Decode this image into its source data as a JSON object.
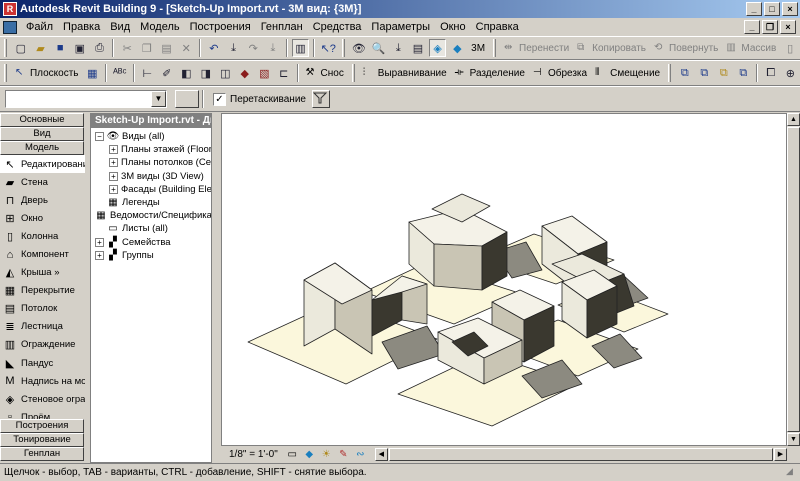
{
  "window": {
    "title": "Autodesk Revit Building 9 - [Sketch-Up Import.rvt - 3M вид: {3M}]",
    "app_icon": "R"
  },
  "menu": [
    "Файл",
    "Правка",
    "Вид",
    "Модель",
    "Построения",
    "Генплан",
    "Средства",
    "Параметры",
    "Окно",
    "Справка"
  ],
  "toolbar1": {
    "view_3d_label": "3M",
    "move_label": "Перенести",
    "copy_label": "Копировать",
    "rotate_label": "Повернуть",
    "array_label": "Массив"
  },
  "toolbar2": {
    "plane_label": "Плоскость",
    "demolish_label": "Снос",
    "align_label": "Выравнивание",
    "split_label": "Разделение",
    "trim_label": "Обрезка",
    "offset_label": "Смещение"
  },
  "optionsbar": {
    "drag_label": "Перетаскивание",
    "drag_checked": "✓"
  },
  "design_bar": {
    "top_tabs": [
      "Основные",
      "Вид",
      "Модель"
    ],
    "tools": [
      {
        "icon": "modify-icon",
        "label": "Редактирование",
        "glyph": "↖"
      },
      {
        "icon": "wall-icon",
        "label": "Стена",
        "glyph": "▰"
      },
      {
        "icon": "door-icon",
        "label": "Дверь",
        "glyph": "⊓"
      },
      {
        "icon": "window-icon",
        "label": "Окно",
        "glyph": "⊞"
      },
      {
        "icon": "column-icon",
        "label": "Колонна",
        "glyph": "▯"
      },
      {
        "icon": "component-icon",
        "label": "Компонент",
        "glyph": "⌂"
      },
      {
        "icon": "roof-icon",
        "label": "Крыша »",
        "glyph": "◭"
      },
      {
        "icon": "floor-icon",
        "label": "Перекрытие",
        "glyph": "▦"
      },
      {
        "icon": "ceiling-icon",
        "label": "Потолок",
        "glyph": "▤"
      },
      {
        "icon": "stair-icon",
        "label": "Лестница",
        "glyph": "≣"
      },
      {
        "icon": "railing-icon",
        "label": "Ограждение",
        "glyph": "▥"
      },
      {
        "icon": "ramp-icon",
        "label": "Пандус",
        "glyph": "◣"
      },
      {
        "icon": "text-icon",
        "label": "Надпись на модели",
        "glyph": "M"
      },
      {
        "icon": "curtain-icon",
        "label": "Стеновое ограждение",
        "glyph": "◈"
      },
      {
        "icon": "opening-icon",
        "label": "Проём",
        "glyph": "▫"
      }
    ],
    "bottom_tabs": [
      "Построения",
      "Тонирование",
      "Генплан"
    ]
  },
  "project_browser": {
    "title": "Sketch-Up Import.rvt - Диспетчер проекта",
    "tree": [
      {
        "label": "Виды (all)",
        "exp": "−",
        "indent": 0,
        "icon": "eye-icon",
        "glyph": "👁"
      },
      {
        "label": "Планы этажей (Floor Plan)",
        "exp": "+",
        "indent": 1,
        "icon": "",
        "glyph": ""
      },
      {
        "label": "Планы потолков (Ceiling Plan)",
        "exp": "+",
        "indent": 1,
        "icon": "",
        "glyph": ""
      },
      {
        "label": "3M виды (3D View)",
        "exp": "+",
        "indent": 1,
        "icon": "",
        "glyph": ""
      },
      {
        "label": "Фасады (Building Elevation)",
        "exp": "+",
        "indent": 1,
        "icon": "",
        "glyph": ""
      },
      {
        "label": "Легенды",
        "exp": "",
        "indent": 0,
        "icon": "legend-icon",
        "glyph": "▦"
      },
      {
        "label": "Ведомости/Спецификации",
        "exp": "",
        "indent": 0,
        "icon": "schedule-icon",
        "glyph": "▦"
      },
      {
        "label": "Листы (all)",
        "exp": "",
        "indent": 0,
        "icon": "sheet-icon",
        "glyph": "▭"
      },
      {
        "label": "Семейства",
        "exp": "+",
        "indent": 0,
        "icon": "family-icon",
        "glyph": "▞"
      },
      {
        "label": "Группы",
        "exp": "+",
        "indent": 0,
        "icon": "group-icon",
        "glyph": "▞"
      }
    ]
  },
  "view_control": {
    "scale": "1/8\" = 1'-0\""
  },
  "status": "Щелчок - выбор, TAB - варианты, CTRL - добавление, SHIFT - снятие выбора.",
  "colors": {
    "site": "#fbf7dc",
    "mass_light": "#ebe9dc",
    "mass_mid": "#c9c5b4",
    "mass_dark": "#3a382f",
    "shadow": "#8c8a80"
  }
}
